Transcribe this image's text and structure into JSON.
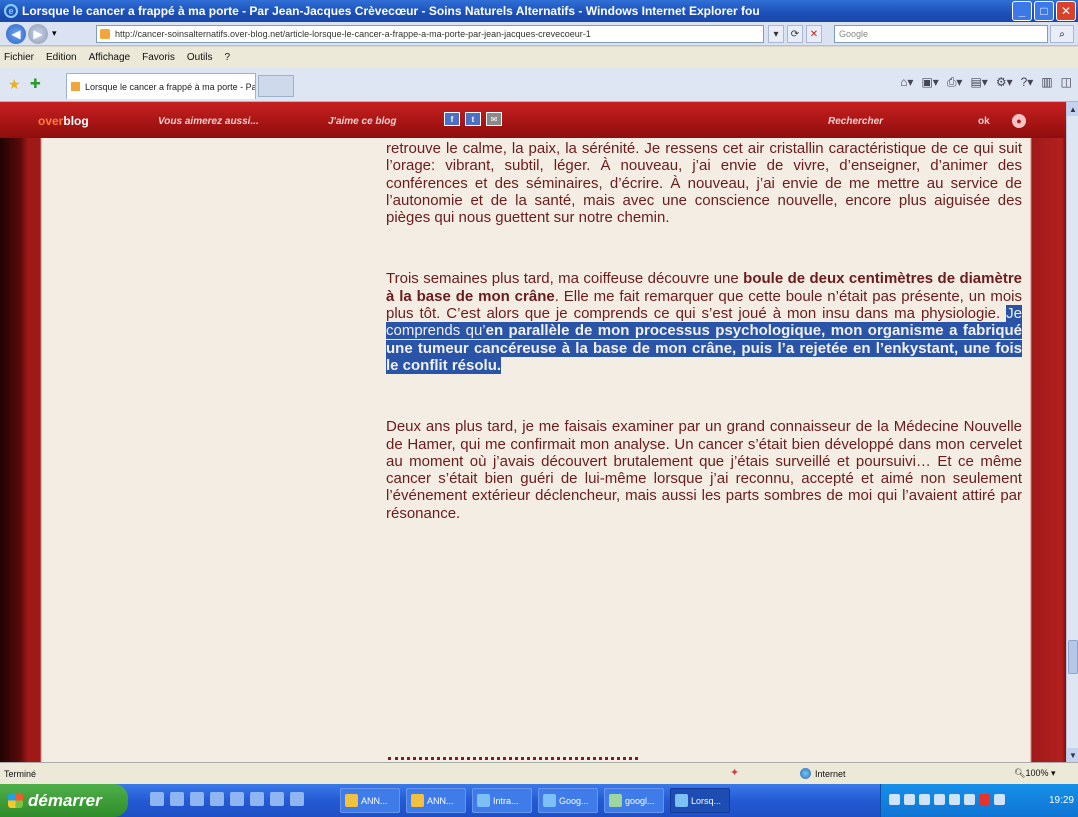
{
  "window": {
    "title": "Lorsque le cancer a frappé à ma porte - Par Jean-Jacques Crèvecœur - Soins Naturels Alternatifs - Windows Internet Explorer fou"
  },
  "address": {
    "url": "http://cancer-soinsalternatifs.over-blog.net/article-lorsque-le-cancer-a-frappe-a-ma-porte-par-jean-jacques-crevecoeur-1",
    "search_placeholder": "Google"
  },
  "menu": [
    "Fichier",
    "Edition",
    "Affichage",
    "Favoris",
    "Outils",
    "?"
  ],
  "tab": {
    "label": "Lorsque le cancer a frappé à ma porte - Par Jean-Jac..."
  },
  "blogbar": {
    "logo_prefix": "over",
    "logo_suffix": "blog",
    "link1": "Vous aimerez aussi...",
    "link2": "J'aime ce blog",
    "search": "Rechercher",
    "ok": "ok"
  },
  "article": {
    "p1": "retrouve le calme, la paix, la sérénité. Je ressens cet air cristallin caractéristique de ce qui suit l’orage: vibrant, subtil, léger. À nouveau, j’ai envie de vivre, d’enseigner, d’animer des conférences et des séminaires, d’écrire. À nouveau, j’ai envie de me mettre au service de l’autonomie et de la santé, mais avec une conscience nouvelle, encore plus aiguisée des pièges qui nous guettent sur notre chemin.",
    "p2_a": "Trois semaines plus tard, ma coiffeuse découvre une ",
    "p2_bold": "boule de deux centimètres de diamètre à la base de mon crâne",
    "p2_b": ". Elle me fait remarquer que cette boule n’était pas présente, un mois plus tôt. C’est alors que je comprends ce qui s’est joué à mon insu dans ma physiologie. ",
    "p2_hl_a": "Je comprends qu’",
    "p2_hl_bold": "en parallèle de mon processus psychologique, mon organisme a fabriqué une tumeur cancéreuse à la base de mon crâne, puis l’a rejetée en l’enkystant, une fois le conflit résolu.",
    "p3": "Deux ans plus tard, je me faisais examiner par un grand connaisseur de la Médecine Nouvelle de Hamer, qui me confirmait mon analyse. Un cancer s’était bien développé dans mon cervelet au moment où j’avais découvert brutalement que j’étais surveillé et poursuivi… Et ce même cancer s’était bien guéri de lui-même lorsque j’ai reconnu, accepté et aimé non seulement l’événement extérieur déclencheur, mais aussi les parts sombres de moi qui l’avaient attiré par résonance."
  },
  "status": {
    "text": "Terminé",
    "zone": "Internet",
    "zoom": "100%"
  },
  "taskbar": {
    "start": "démarrer",
    "tasks": [
      "ANN...",
      "ANN...",
      "Intra...",
      "Goog...",
      "googl...",
      "Lorsq..."
    ],
    "clock": "19:29"
  }
}
